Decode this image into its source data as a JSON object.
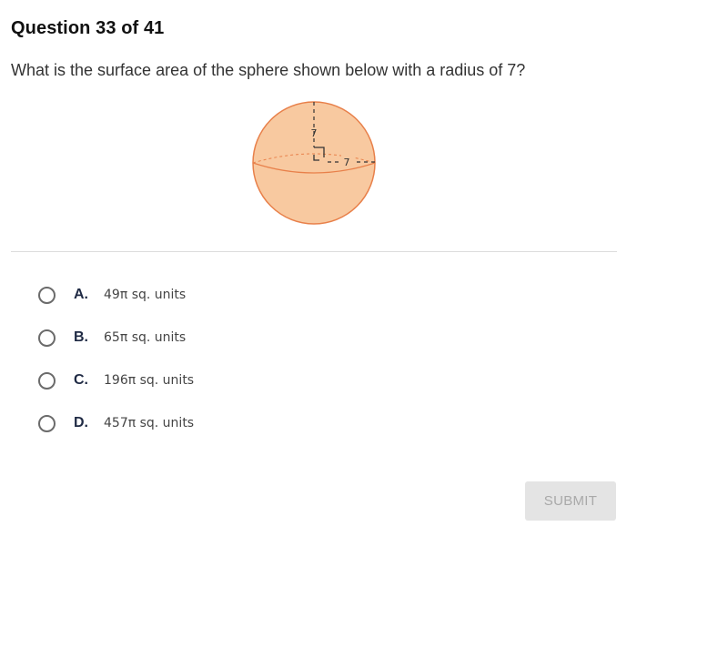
{
  "header": {
    "title": "Question 33 of 41"
  },
  "question": {
    "text": "What is the surface area of the sphere shown below with a radius of 7?"
  },
  "figure": {
    "vertical_label": "7",
    "horizontal_label": "7",
    "fill_color": "#f8c9a0",
    "stroke_color": "#e8804a"
  },
  "options": [
    {
      "letter": "A.",
      "text": "49π sq. units"
    },
    {
      "letter": "B.",
      "text": "65π sq. units"
    },
    {
      "letter": "C.",
      "text": "196π sq. units"
    },
    {
      "letter": "D.",
      "text": "457π sq. units"
    }
  ],
  "submit": {
    "label": "SUBMIT"
  }
}
